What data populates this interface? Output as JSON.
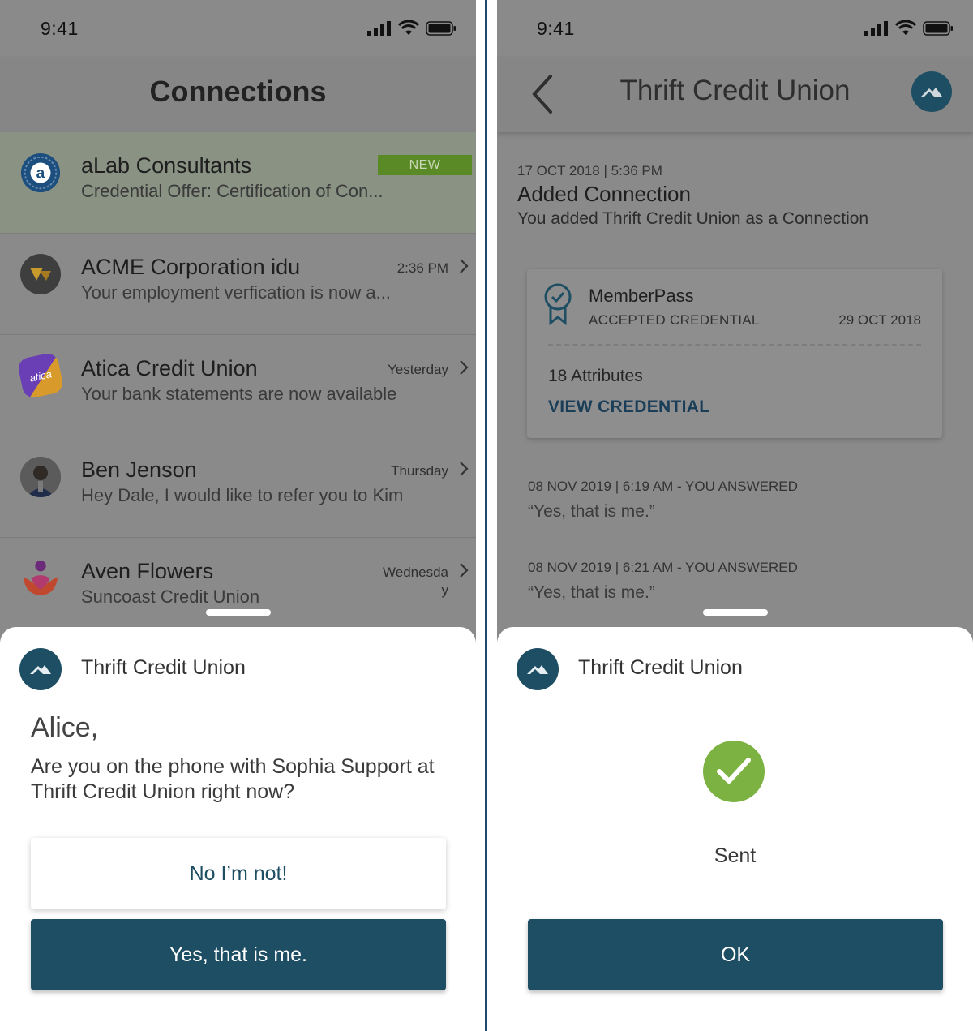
{
  "left": {
    "status": {
      "time": "9:41"
    },
    "header": {
      "title": "Connections"
    },
    "connections": [
      {
        "name": "aLab Consultants",
        "subtitle": "Credential Offer: Certification of Con...",
        "badge": "NEW",
        "time": ""
      },
      {
        "name": "ACME Corporation idu",
        "subtitle": "Your employment verfication is now a...",
        "time": "2:36 PM"
      },
      {
        "name": "Atica Credit Union",
        "subtitle": "Your bank statements are now available",
        "time": "Yesterday",
        "avatar_text": "atica"
      },
      {
        "name": "Ben Jenson",
        "subtitle": "Hey Dale, I would like to refer you to Kim",
        "time": "Thursday"
      },
      {
        "name": "Aven Flowers",
        "subtitle": "Suncoast Credit Union",
        "time": "Wednesday"
      }
    ],
    "sheet": {
      "org": "Thrift Credit Union",
      "greeting": "Alice,",
      "question": "Are you on the phone with Sophia Support at Thrift Credit Union right now?",
      "no_label": "No I’m not!",
      "yes_label": "Yes, that is me."
    }
  },
  "right": {
    "status": {
      "time": "9:41"
    },
    "header": {
      "title": "Thrift Credit Union"
    },
    "event": {
      "date": "17 OCT 2018 | 5:36 PM",
      "title": "Added Connection",
      "description": "You added Thrift Credit Union as a Connection"
    },
    "credential": {
      "name": "MemberPass",
      "status": "ACCEPTED CREDENTIAL",
      "date": "29 OCT 2018",
      "attributes": "18 Attributes",
      "link": "VIEW CREDENTIAL"
    },
    "answers": [
      {
        "date": "08 NOV 2019 | 6:19 AM - YOU ANSWERED",
        "text": "“Yes, that is me.”"
      },
      {
        "date": "08 NOV 2019 | 6:21 AM - YOU ANSWERED",
        "text": "“Yes, that is me.”"
      }
    ],
    "sheet": {
      "org": "Thrift Credit Union",
      "sent_label": "Sent",
      "ok_label": "OK"
    }
  },
  "colors": {
    "brand": "#1e4e63",
    "new_badge": "#5a8a26",
    "success": "#7bb241",
    "overlay_bg": "#8a8a8a"
  },
  "icons": [
    "signal-icon",
    "wifi-icon",
    "battery-icon",
    "chevron-right-icon",
    "back-arrow-icon",
    "mountain-logo-icon",
    "ribbon-badge-icon",
    "checkmark-icon"
  ]
}
